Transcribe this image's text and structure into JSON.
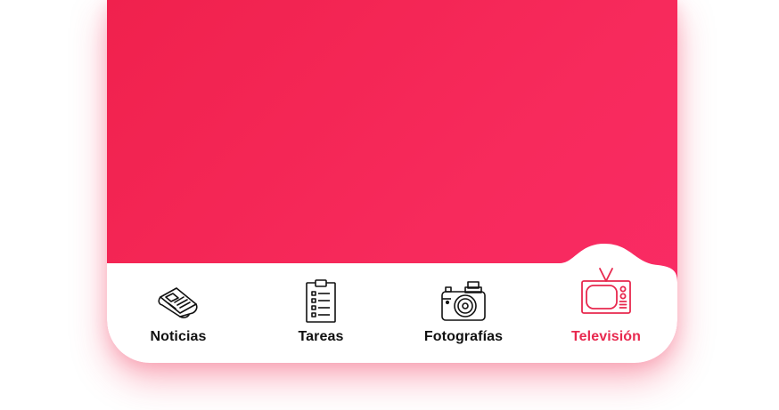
{
  "colors": {
    "accent": "#e8294f",
    "background_gradient_start": "#f0214d",
    "background_gradient_end": "#fa2b66",
    "tabbar_background": "#ffffff",
    "inactive_label": "#111111"
  },
  "tabbar": {
    "active_index": 3,
    "items": [
      {
        "label": "Noticias",
        "icon": "newspaper-icon"
      },
      {
        "label": "Tareas",
        "icon": "clipboard-list-icon"
      },
      {
        "label": "Fotografías",
        "icon": "camera-icon"
      },
      {
        "label": "Televisión",
        "icon": "television-icon"
      }
    ]
  }
}
